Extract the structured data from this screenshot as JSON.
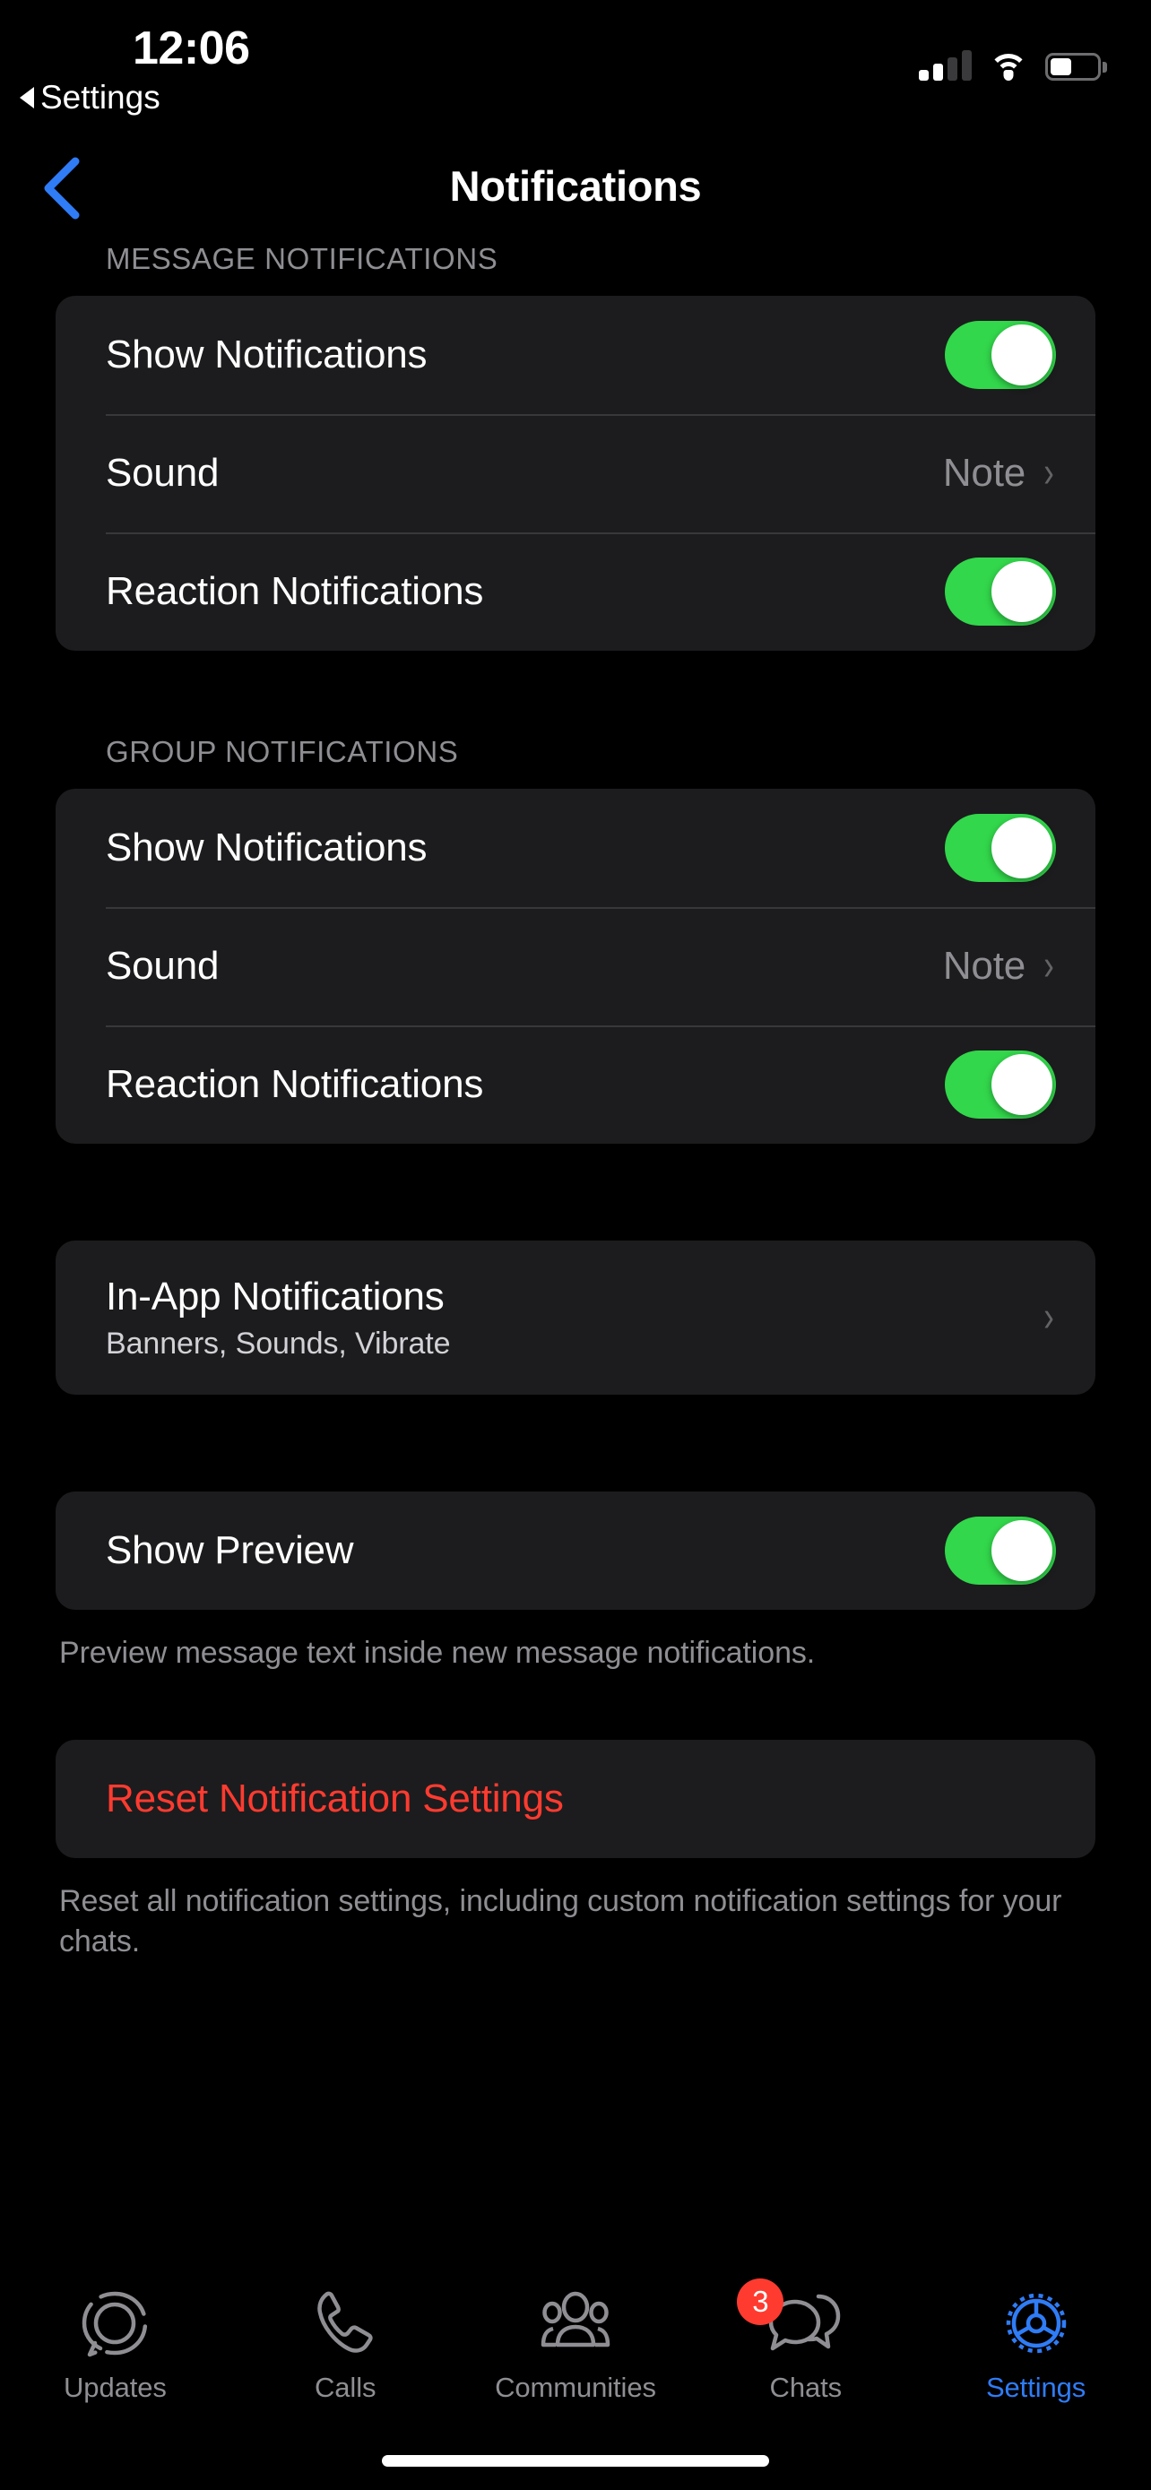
{
  "status_bar": {
    "time": "12:06",
    "back_hint": "Settings",
    "signal_bars_filled": 2,
    "signal_bars_total": 4,
    "wifi": "wifi-full",
    "battery_percent": 40
  },
  "nav": {
    "title": "Notifications",
    "back_icon": "chevron-left-icon",
    "back_color": "#2f7cf6"
  },
  "colors": {
    "background": "#000000",
    "card": "#1c1c1e",
    "separator": "#38383a",
    "toggle_on": "#32d74b",
    "secondary_text": "#8e8e93",
    "destructive": "#ff3b30",
    "accent": "#2f7cf6",
    "badge": "#ff3b30"
  },
  "sections": [
    {
      "header": "MESSAGE NOTIFICATIONS",
      "rows": [
        {
          "label": "Show Notifications",
          "type": "toggle",
          "value": "on"
        },
        {
          "label": "Sound",
          "type": "disclosure",
          "value": "Note"
        },
        {
          "label": "Reaction Notifications",
          "type": "toggle",
          "value": "on"
        }
      ]
    },
    {
      "header": "GROUP NOTIFICATIONS",
      "rows": [
        {
          "label": "Show Notifications",
          "type": "toggle",
          "value": "on"
        },
        {
          "label": "Sound",
          "type": "disclosure",
          "value": "Note"
        },
        {
          "label": "Reaction Notifications",
          "type": "toggle",
          "value": "on"
        }
      ]
    },
    {
      "header": "",
      "rows": [
        {
          "label": "In-App Notifications",
          "subtitle": "Banners, Sounds, Vibrate",
          "type": "disclosure",
          "value": ""
        }
      ]
    },
    {
      "header": "",
      "rows": [
        {
          "label": "Show Preview",
          "type": "toggle",
          "value": "on"
        }
      ],
      "footer": "Preview message text inside new message notifications."
    },
    {
      "header": "",
      "rows": [
        {
          "label": "Reset Notification Settings",
          "type": "destructive"
        }
      ],
      "footer": "Reset all notification settings, including custom notification settings for your chats."
    }
  ],
  "tabs": [
    {
      "label": "Updates",
      "icon": "updates-icon",
      "active": false,
      "badge": ""
    },
    {
      "label": "Calls",
      "icon": "phone-icon",
      "active": false,
      "badge": ""
    },
    {
      "label": "Communities",
      "icon": "communities-icon",
      "active": false,
      "badge": ""
    },
    {
      "label": "Chats",
      "icon": "chats-icon",
      "active": false,
      "badge": "3"
    },
    {
      "label": "Settings",
      "icon": "gear-icon",
      "active": true,
      "badge": ""
    }
  ]
}
